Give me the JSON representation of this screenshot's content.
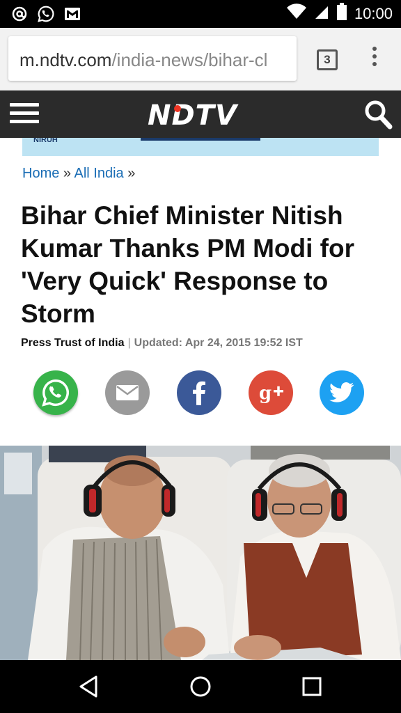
{
  "status_bar": {
    "time": "10:00",
    "left_icons": [
      "at-icon",
      "whatsapp-notification-icon",
      "gmail-icon"
    ],
    "right_icons": [
      "wifi-icon",
      "signal-icon",
      "battery-icon"
    ]
  },
  "browser": {
    "url_host": "m.ndtv.com",
    "url_path": "/india-news/bihar-cl",
    "tab_count": "3"
  },
  "site": {
    "logo_text": "NDTV"
  },
  "ad": {
    "text": "NIRUH"
  },
  "breadcrumb": {
    "home": "Home",
    "sep1": " » ",
    "section": "All India",
    "sep2": " »"
  },
  "article": {
    "headline": "Bihar Chief Minister Nitish Kumar Thanks PM Modi for 'Very Quick' Response to Storm",
    "author": "Press Trust of India",
    "separator": "|",
    "updated": "Updated: Apr 24, 2015 19:52 IST"
  },
  "share": {
    "icons": [
      "whatsapp-icon",
      "email-icon",
      "facebook-icon",
      "google-plus-icon",
      "twitter-icon"
    ],
    "colors": {
      "whatsapp": "#37b34a",
      "email": "#9a9a9a",
      "facebook": "#3b5998",
      "google_plus": "#dd4b39",
      "twitter": "#1da1f2"
    }
  },
  "colors": {
    "header_bg": "#2b2b2b",
    "link": "#1a6db5",
    "logo_dot": "#ee3322"
  },
  "nav": {
    "icons": [
      "back-icon",
      "home-icon",
      "recents-icon"
    ]
  }
}
